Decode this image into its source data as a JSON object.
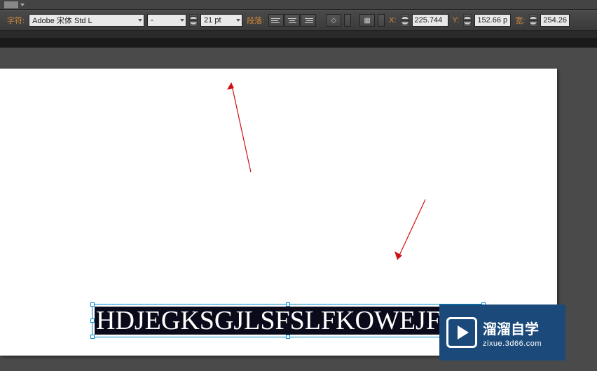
{
  "toolbar": {
    "char_label": "字符:",
    "font_family": "Adobe 宋体 Std L",
    "font_style": "-",
    "font_size": "21 pt",
    "paragraph_label": "段落:",
    "x_label": "X:",
    "x_value": "225.744",
    "y_label": "Y:",
    "y_value": "152.66 p",
    "w_label": "宽:",
    "w_value": "254.26"
  },
  "canvas": {
    "selected_text": "HDJEGKSGJLSFSLFKOWEJF"
  },
  "watermark": {
    "title": "溜溜自学",
    "url": "zixue.3d66.com"
  }
}
